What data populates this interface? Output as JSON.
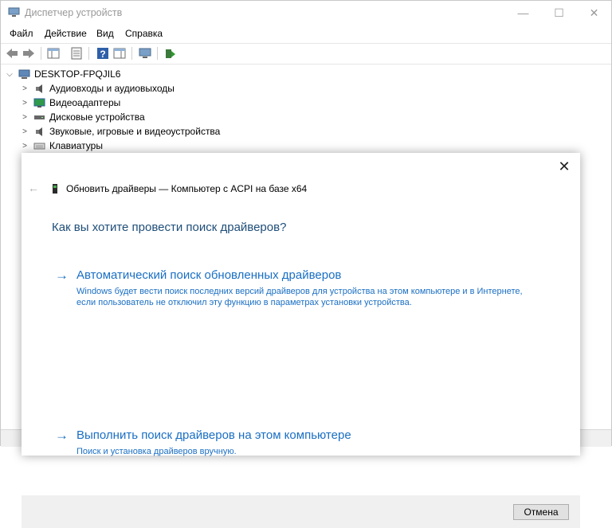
{
  "window": {
    "title": "Диспетчер устройств",
    "controls": {
      "minimize": "—",
      "maximize": "☐",
      "close": "✕"
    }
  },
  "menu": [
    "Файл",
    "Действие",
    "Вид",
    "Справка"
  ],
  "toolbar_icons": [
    "back-arrow-icon",
    "forward-arrow-icon",
    "show-hide-console-tree-icon",
    "properties-icon",
    "help-icon",
    "action-pane-icon",
    "scan-hardware-icon",
    "update-driver-icon"
  ],
  "tree": {
    "root": "DESKTOP-FPQJIL6",
    "items": [
      "Аудиовходы и аудиовыходы",
      "Видеоадаптеры",
      "Дисковые устройства",
      "Звуковые, игровые и видеоустройства",
      "Клавиатуры"
    ]
  },
  "dialog": {
    "header": "Обновить драйверы — Компьютер с ACPI на базе x64",
    "question": "Как вы хотите провести поиск драйверов?",
    "options": [
      {
        "title": "Автоматический поиск обновленных драйверов",
        "desc": "Windows будет вести поиск последних версий драйверов для устройства на этом компьютере и в Интернете, если пользователь не отключил эту функцию в параметрах установки устройства."
      },
      {
        "title": "Выполнить поиск драйверов на этом компьютере",
        "desc": "Поиск и установка драйверов вручную."
      }
    ],
    "cancel_label": "Отмена",
    "close_glyph": "✕",
    "back_glyph": "←",
    "arrow_glyph": "→"
  },
  "colors": {
    "accent_link": "#1a6fc4",
    "question": "#1f4e79"
  }
}
